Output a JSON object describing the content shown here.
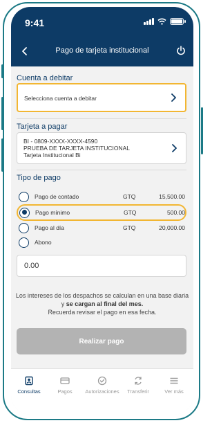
{
  "status_bar": {
    "time": "9:41"
  },
  "header": {
    "title": "Pago de tarjeta institucional"
  },
  "cuenta_debitar": {
    "label": "Cuenta a debitar",
    "placeholder": "Selecciona cuenta a debitar"
  },
  "tarjeta_pagar": {
    "label": "Tarjeta a pagar",
    "line1": "BI - 0809-XXXX-XXXX-4590",
    "line2": "PRUEBA DE TARJETA INSTITUCIONAL",
    "line3": "Tarjeta Institucional Bi"
  },
  "tipo_pago": {
    "label": "Tipo de pago",
    "options": [
      {
        "label": "Pago de contado",
        "currency": "GTQ",
        "amount": "15,500.00",
        "selected": false
      },
      {
        "label": "Pago mínimo",
        "currency": "GTQ",
        "amount": "500.00",
        "selected": true
      },
      {
        "label": "Pago al día",
        "currency": "GTQ",
        "amount": "20,000.00",
        "selected": false
      },
      {
        "label": "Abono",
        "currency": "",
        "amount": "",
        "selected": false
      }
    ],
    "amount_value": "0.00"
  },
  "info": {
    "part1": "Los intereses de los despachos se calculan en una base diaria y ",
    "part2": "se cargan al final del mes.",
    "part3": "Recuerda revisar el pago en esa fecha."
  },
  "submit_button": {
    "label": "Realizar pago"
  },
  "tabbar": {
    "items": [
      {
        "label": "Consultas",
        "icon": "user-card-icon",
        "active": true
      },
      {
        "label": "Pagos",
        "icon": "card-icon",
        "active": false
      },
      {
        "label": "Autorizaciones",
        "icon": "check-circle-icon",
        "active": false
      },
      {
        "label": "Transferir",
        "icon": "transfer-icon",
        "active": false
      },
      {
        "label": "Ver más",
        "icon": "menu-icon",
        "active": false
      }
    ]
  },
  "colors": {
    "primary": "#0d3b66",
    "highlight": "#f2b632",
    "frame": "#1c7a86",
    "disabled_button": "#b3b3b3"
  }
}
